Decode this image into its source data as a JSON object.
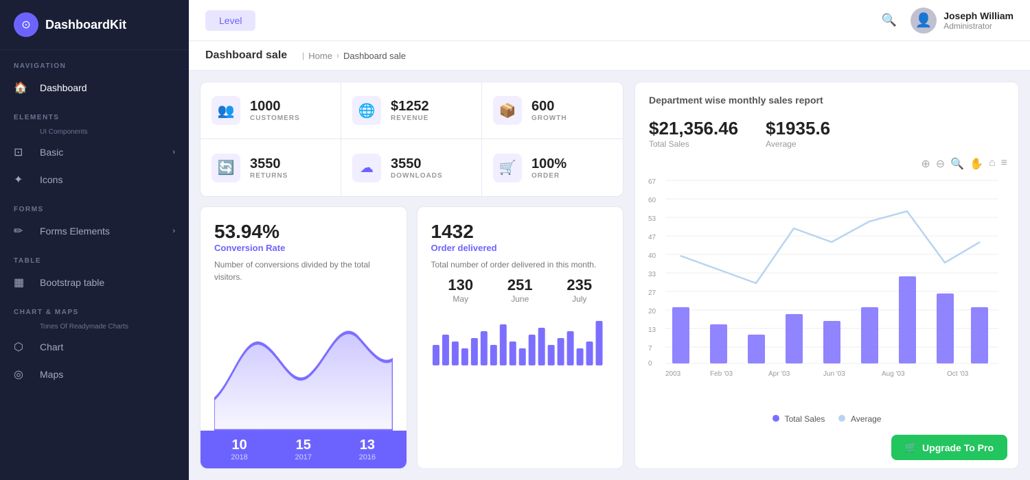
{
  "brand": {
    "name": "DashboardKit",
    "icon": "⊙"
  },
  "sidebar": {
    "nav_label": "NAVIGATION",
    "elements_label": "ELEMENTS",
    "elements_sub": "UI Components",
    "forms_label": "FORMS",
    "table_label": "TABLE",
    "chart_label": "CHART & MAPS",
    "chart_sub": "Tones Of Readymade Charts",
    "items": [
      {
        "id": "dashboard",
        "label": "Dashboard",
        "icon": "⊞",
        "active": true
      },
      {
        "id": "basic",
        "label": "Basic",
        "icon": "⊡",
        "has_arrow": true
      },
      {
        "id": "icons",
        "label": "Icons",
        "icon": "✦"
      },
      {
        "id": "forms-elements",
        "label": "Forms Elements",
        "icon": "✏",
        "has_arrow": true
      },
      {
        "id": "bootstrap-table",
        "label": "Bootstrap table",
        "icon": "▦"
      },
      {
        "id": "chart",
        "label": "Chart",
        "icon": "⬡"
      },
      {
        "id": "maps",
        "label": "Maps",
        "icon": "◎"
      }
    ]
  },
  "header": {
    "level_btn": "Level",
    "user": {
      "name": "Joseph William",
      "role": "Administrator"
    }
  },
  "breadcrumb": {
    "title": "Dashboard sale",
    "home": "Home",
    "current": "Dashboard sale"
  },
  "stats": [
    {
      "id": "customers",
      "value": "1000",
      "label": "CUSTOMERS",
      "icon": "👥"
    },
    {
      "id": "revenue",
      "value": "$1252",
      "label": "REVENUE",
      "icon": "🌐"
    },
    {
      "id": "growth",
      "value": "600",
      "label": "GROWTH",
      "icon": "📦"
    },
    {
      "id": "returns",
      "value": "3550",
      "label": "RETURNS",
      "icon": "🔄"
    },
    {
      "id": "downloads",
      "value": "3550",
      "label": "DOWNLOADS",
      "icon": "☁"
    },
    {
      "id": "order",
      "value": "100%",
      "label": "ORDER",
      "icon": "🛒"
    }
  ],
  "conversion": {
    "rate": "53.94%",
    "label": "Conversion Rate",
    "desc": "Number of conversions divided by the total visitors.",
    "years": [
      {
        "num": "10",
        "year": "2018"
      },
      {
        "num": "15",
        "year": "2017"
      },
      {
        "num": "13",
        "year": "2016"
      }
    ]
  },
  "orders": {
    "count": "1432",
    "label": "Order delivered",
    "desc": "Total number of order delivered in this month.",
    "months": [
      {
        "val": "130",
        "name": "May"
      },
      {
        "val": "251",
        "name": "June"
      },
      {
        "val": "235",
        "name": "July"
      }
    ]
  },
  "sales_report": {
    "title": "Department wise monthly sales report",
    "total_sales": "$21,356.46",
    "total_sales_label": "Total Sales",
    "average": "$1935.6",
    "average_label": "Average",
    "legend": {
      "total_sales": "Total Sales",
      "average": "Average"
    },
    "toolbar": [
      "⊕",
      "⊖",
      "🔍",
      "✋",
      "⌂",
      "≡"
    ],
    "y_axis": [
      "67",
      "60",
      "53",
      "47",
      "40",
      "33",
      "27",
      "20",
      "13",
      "7",
      "0"
    ],
    "x_axis": [
      "2003",
      "Feb '03",
      "Apr '03",
      "Jun '03",
      "Aug '03",
      "Oct '03"
    ]
  },
  "upgrade": {
    "label": "Upgrade To Pro",
    "icon": "🛒"
  }
}
